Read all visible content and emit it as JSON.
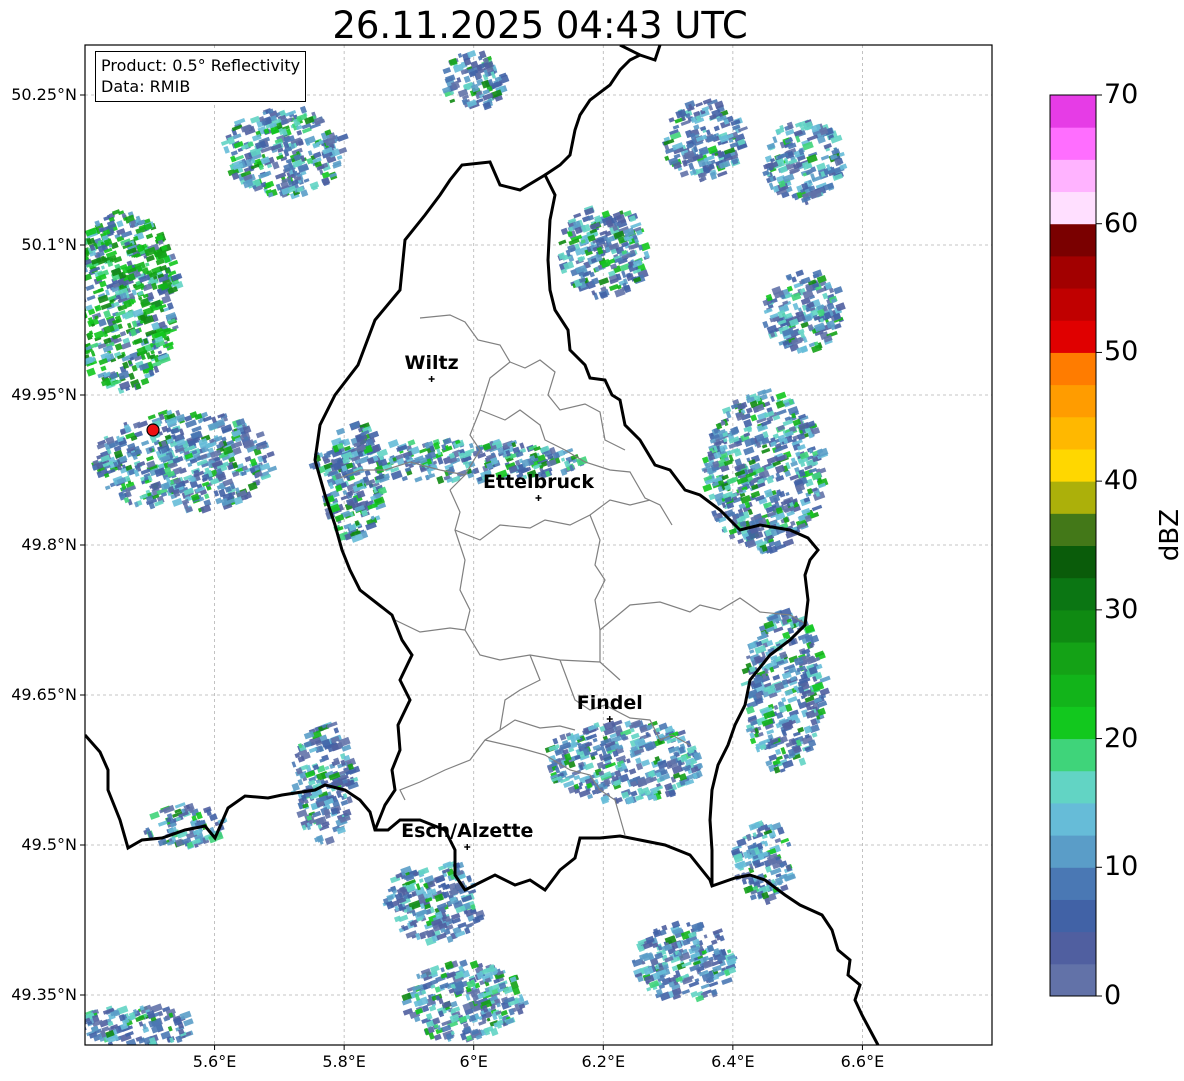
{
  "title": "26.11.2025 04:43 UTC",
  "info": {
    "product": "Product: 0.5° Reflectivity",
    "data": "Data: RMIB"
  },
  "lat_ticks": [
    "50.25°N",
    "50.1°N",
    "49.95°N",
    "49.8°N",
    "49.65°N",
    "49.5°N",
    "49.35°N"
  ],
  "lon_ticks": [
    "5.6°E",
    "5.8°E",
    "6°E",
    "6.2°E",
    "6.4°E",
    "6.6°E"
  ],
  "cities": [
    {
      "name": "Wiltz",
      "lon": 5.935,
      "lat": 49.966
    },
    {
      "name": "Ettelbruck",
      "lon": 6.1,
      "lat": 49.847
    },
    {
      "name": "Findel",
      "lon": 6.21,
      "lat": 49.626
    },
    {
      "name": "Esch/Alzette",
      "lon": 5.99,
      "lat": 49.498
    }
  ],
  "radar_site": {
    "lon": 5.505,
    "lat": 49.915,
    "color": "#ee1111"
  },
  "colorbar": {
    "label": "dBZ",
    "min": 0,
    "max": 70,
    "ticks": [
      "0",
      "10",
      "20",
      "30",
      "40",
      "50",
      "60",
      "70"
    ],
    "colors": [
      "#6272a8",
      "#505fa0",
      "#4162a6",
      "#4a78b4",
      "#5a9dc8",
      "#66bcd8",
      "#62d4c4",
      "#3fd47a",
      "#12c81e",
      "#12b41a",
      "#14a216",
      "#0f8a12",
      "#0b7613",
      "#0a5c0a",
      "#437818",
      "#acb00a",
      "#ffd700",
      "#ffb800",
      "#ff9c00",
      "#ff7c00",
      "#e00000",
      "#c00000",
      "#a20000",
      "#7a0000",
      "#ffdfff",
      "#ffb3ff",
      "#ff6eff",
      "#e63ce6"
    ]
  },
  "map_extent": {
    "lon_min": 5.4,
    "lon_max": 6.8,
    "lat_min": 49.3,
    "lat_max": 50.3
  }
}
